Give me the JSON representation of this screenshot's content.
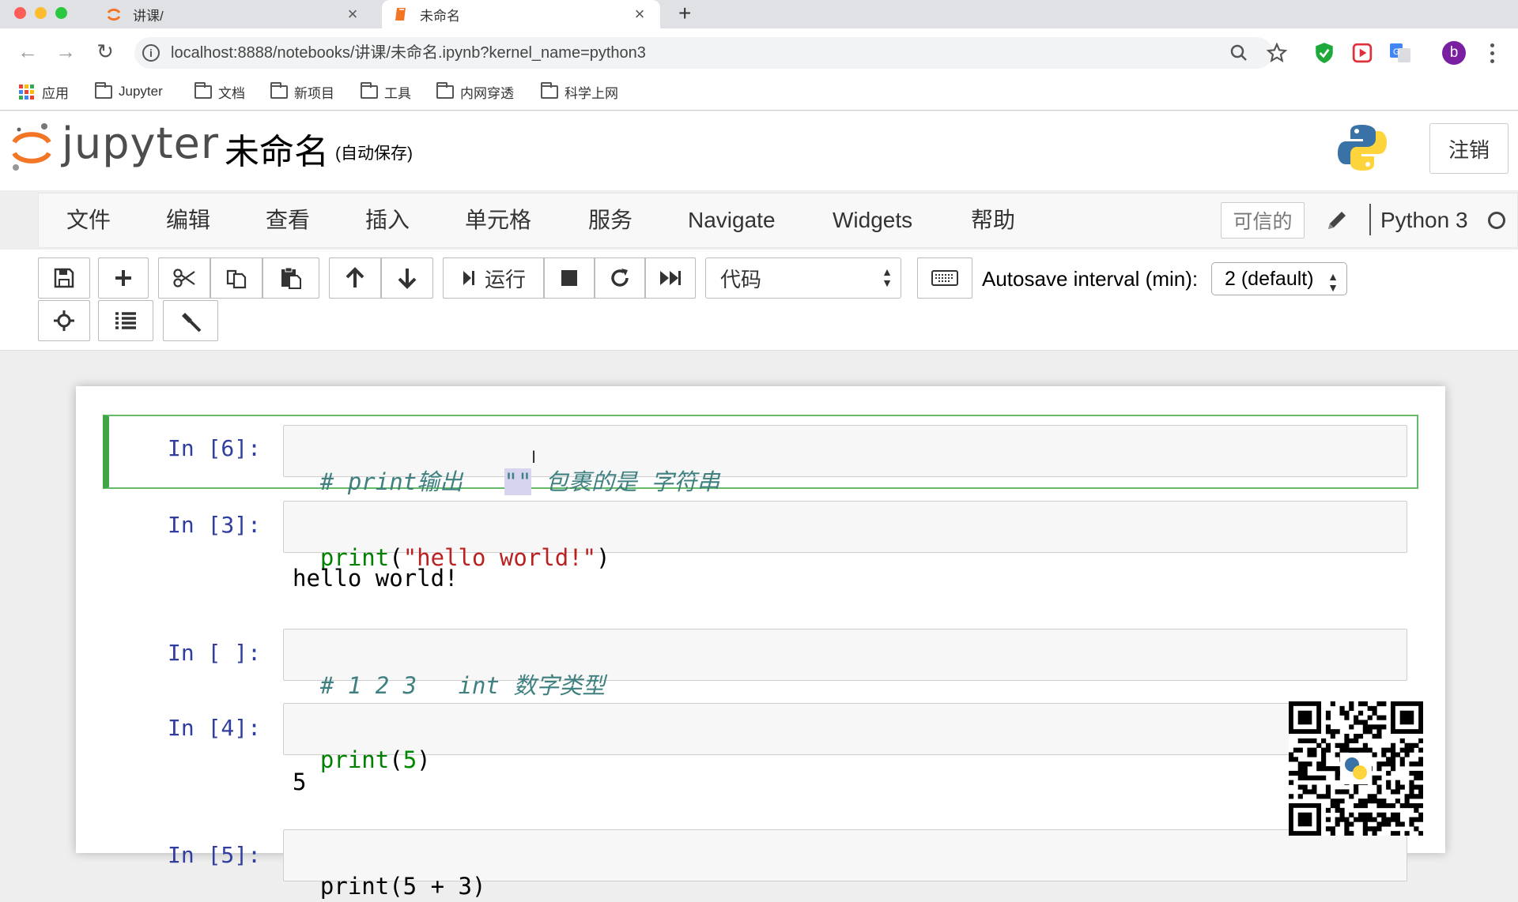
{
  "browser": {
    "tabs": [
      {
        "title": "讲课/",
        "active": false
      },
      {
        "title": "未命名",
        "active": true
      }
    ],
    "close_glyph": "×",
    "new_tab_glyph": "+",
    "url": "localhost:8888/notebooks/讲课/未命名.ipynb?kernel_name=python3",
    "bookmarks": [
      "应用",
      "Jupyter",
      "文档",
      "新项目",
      "工具",
      "内网穿透",
      "科学上网"
    ],
    "profile_initial": "b"
  },
  "jupyter": {
    "logo_text": "jupyter",
    "notebook_name": "未命名",
    "autosave_status": "(自动保存)",
    "logout_label": "注销",
    "menu": [
      "文件",
      "编辑",
      "查看",
      "插入",
      "单元格",
      "服务",
      "Navigate",
      "Widgets",
      "帮助"
    ],
    "trusted_label": "可信的",
    "kernel_name": "Python 3",
    "run_label": "运行",
    "cell_type": "代码",
    "autosave_label": "Autosave interval (min):",
    "autosave_value": "2 (default)"
  },
  "cells": [
    {
      "prompt": "In [6]:",
      "selected": true,
      "code_comment": "# print输出   ",
      "code_highlight": "\"\"",
      "code_comment_rest": " 包裹的是 字符串"
    },
    {
      "prompt": "In [3]:",
      "code_builtin": "print",
      "code_open": "(",
      "code_string": "\"hello world!\"",
      "code_close": ")",
      "output": "hello world!"
    },
    {
      "prompt": "In [ ]:",
      "code_comment": "# 1 2 3   int 数字类型"
    },
    {
      "prompt": "In [4]:",
      "code_builtin": "print",
      "code_open": "(",
      "code_num": "5",
      "code_close": ")",
      "output": "5"
    },
    {
      "prompt": "In [5]:",
      "code_partial": "print(5 + 3)"
    }
  ],
  "colors": {
    "selected_cell": "#42a545",
    "prompt": "#303f9f",
    "comment": "#408080",
    "builtin": "#008000",
    "string": "#ba2121"
  }
}
